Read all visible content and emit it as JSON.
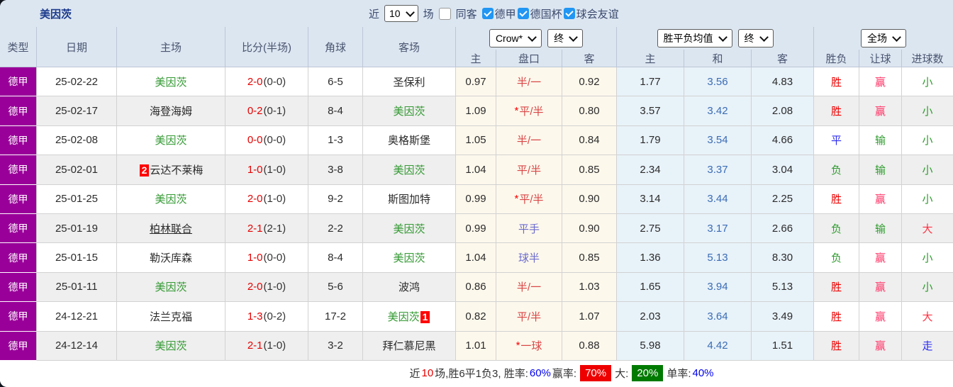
{
  "title": "美因茨",
  "filter": {
    "near_label": "近",
    "near_value": "10",
    "matches_label": "场",
    "same_venue_label": "同客",
    "leagues": [
      "德甲",
      "德国杯",
      "球会友谊"
    ]
  },
  "header": {
    "cols": [
      "类型",
      "日期",
      "主场",
      "比分(半场)",
      "角球",
      "客场"
    ],
    "selects": {
      "book": "Crow*",
      "book_state": "终",
      "avg": "胜平负均值",
      "avg_state": "终",
      "scope": "全场"
    },
    "sub": [
      "主",
      "盘口",
      "客",
      "主",
      "和",
      "客",
      "胜负",
      "让球",
      "进球数"
    ]
  },
  "theme": {
    "purple": "#990099",
    "team_green": "#339933",
    "score_red": "#e60000",
    "pan_red": "#d94545",
    "pan_blue": "#6a6ace",
    "value_colors": {
      "胜": "#ee0000",
      "平": "#2b2bf0",
      "负": "#2e9b2e",
      "赢": "#ff3366",
      "输": "#2e9b2e",
      "小": "#2e9b2e",
      "大": "#ff3344",
      "走": "#2b2bf0"
    }
  },
  "rows": [
    {
      "league": "德甲",
      "date": "25-02-22",
      "home": {
        "name": "美因茨",
        "green": true
      },
      "score": "2-0",
      "half": "(0-0)",
      "corner": "6-5",
      "away": {
        "name": "圣保利"
      },
      "o1": "0.97",
      "pan": "半/一",
      "o2": "0.92",
      "a1": "1.77",
      "a2": "3.56",
      "a3": "4.83",
      "r1": "胜",
      "r2": "赢",
      "r3": "小"
    },
    {
      "league": "德甲",
      "date": "25-02-17",
      "home": {
        "name": "海登海姆"
      },
      "score": "0-2",
      "half": "(0-1)",
      "corner": "8-4",
      "away": {
        "name": "美因茨",
        "green": true
      },
      "o1": "1.09",
      "pan": "*平/半",
      "o2": "0.80",
      "a1": "3.57",
      "a2": "3.42",
      "a3": "2.08",
      "r1": "胜",
      "r2": "赢",
      "r3": "小"
    },
    {
      "league": "德甲",
      "date": "25-02-08",
      "home": {
        "name": "美因茨",
        "green": true
      },
      "score": "0-0",
      "half": "(0-0)",
      "corner": "1-3",
      "away": {
        "name": "奥格斯堡"
      },
      "o1": "1.05",
      "pan": "半/一",
      "o2": "0.84",
      "a1": "1.79",
      "a2": "3.54",
      "a3": "4.66",
      "r1": "平",
      "r2": "输",
      "r3": "小"
    },
    {
      "league": "德甲",
      "date": "25-02-01",
      "home": {
        "name": "云达不莱梅",
        "badge": "2",
        "badge_pos": "before"
      },
      "score": "1-0",
      "half": "(1-0)",
      "corner": "3-8",
      "away": {
        "name": "美因茨",
        "green": true
      },
      "o1": "1.04",
      "pan": "平/半",
      "o2": "0.85",
      "a1": "2.34",
      "a2": "3.37",
      "a3": "3.04",
      "r1": "负",
      "r2": "输",
      "r3": "小"
    },
    {
      "league": "德甲",
      "date": "25-01-25",
      "home": {
        "name": "美因茨",
        "green": true
      },
      "score": "2-0",
      "half": "(1-0)",
      "corner": "9-2",
      "away": {
        "name": "斯图加特"
      },
      "o1": "0.99",
      "pan": "*平/半",
      "o2": "0.90",
      "a1": "3.14",
      "a2": "3.44",
      "a3": "2.25",
      "r1": "胜",
      "r2": "赢",
      "r3": "小"
    },
    {
      "league": "德甲",
      "date": "25-01-19",
      "home": {
        "name": "柏林联合",
        "underline": true
      },
      "score": "2-1",
      "half": "(2-1)",
      "corner": "2-2",
      "away": {
        "name": "美因茨",
        "green": true
      },
      "o1": "0.99",
      "pan": "平手",
      "o2": "0.90",
      "a1": "2.75",
      "a2": "3.17",
      "a3": "2.66",
      "r1": "负",
      "r2": "输",
      "r3": "大"
    },
    {
      "league": "德甲",
      "date": "25-01-15",
      "home": {
        "name": "勒沃库森"
      },
      "score": "1-0",
      "half": "(0-0)",
      "corner": "8-4",
      "away": {
        "name": "美因茨",
        "green": true
      },
      "o1": "1.04",
      "pan": "球半",
      "o2": "0.85",
      "a1": "1.36",
      "a2": "5.13",
      "a3": "8.30",
      "r1": "负",
      "r2": "赢",
      "r3": "小"
    },
    {
      "league": "德甲",
      "date": "25-01-11",
      "home": {
        "name": "美因茨",
        "green": true
      },
      "score": "2-0",
      "half": "(1-0)",
      "corner": "5-6",
      "away": {
        "name": "波鸿"
      },
      "o1": "0.86",
      "pan": "半/一",
      "o2": "1.03",
      "a1": "1.65",
      "a2": "3.94",
      "a3": "5.13",
      "r1": "胜",
      "r2": "赢",
      "r3": "小"
    },
    {
      "league": "德甲",
      "date": "24-12-21",
      "home": {
        "name": "法兰克福"
      },
      "score": "1-3",
      "half": "(0-2)",
      "corner": "17-2",
      "away": {
        "name": "美因茨",
        "green": true,
        "badge": "1",
        "badge_pos": "after"
      },
      "o1": "0.82",
      "pan": "平/半",
      "o2": "1.07",
      "a1": "2.03",
      "a2": "3.64",
      "a3": "3.49",
      "r1": "胜",
      "r2": "赢",
      "r3": "大"
    },
    {
      "league": "德甲",
      "date": "24-12-14",
      "home": {
        "name": "美因茨",
        "green": true
      },
      "score": "2-1",
      "half": "(1-0)",
      "corner": "3-2",
      "away": {
        "name": "拜仁慕尼黑"
      },
      "o1": "1.01",
      "pan": "*一球",
      "o2": "0.88",
      "a1": "5.98",
      "a2": "4.42",
      "a3": "1.51",
      "r1": "胜",
      "r2": "赢",
      "r3": "走"
    }
  ],
  "footer": {
    "segments": [
      {
        "t": "近",
        "c": "#333"
      },
      {
        "t": "10",
        "c": "#e60000"
      },
      {
        "t": "场,胜6平1负3, 胜率:",
        "c": "#333"
      },
      {
        "t": "60%",
        "c": "#0000ee"
      },
      {
        "t": " 赢率:",
        "c": "#333"
      },
      {
        "t": "70%",
        "c": "#fff",
        "bg": "#ee0000"
      },
      {
        "t": " 大:",
        "c": "#333"
      },
      {
        "t": "20%",
        "c": "#fff",
        "bg": "#007a00"
      },
      {
        "t": " 单率:",
        "c": "#333"
      },
      {
        "t": "40%",
        "c": "#0000ee"
      }
    ]
  }
}
